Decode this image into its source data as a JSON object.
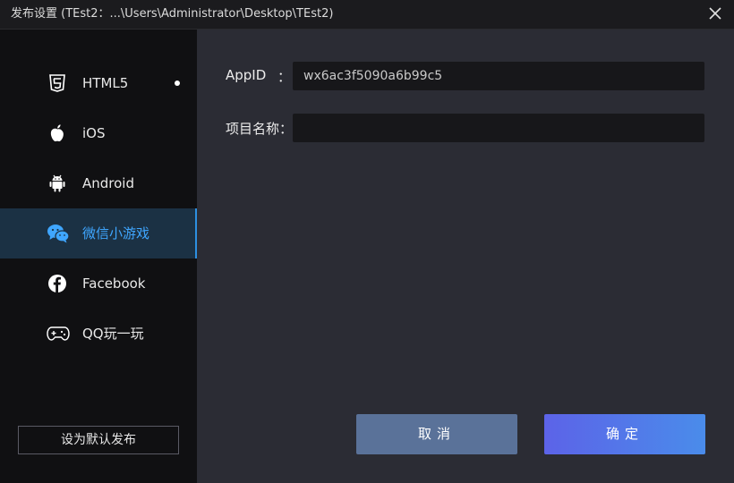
{
  "window": {
    "title": "发布设置 (TEst2：...\\Users\\Administrator\\Desktop\\TEst2)",
    "close_icon": "close-icon"
  },
  "sidebar": {
    "items": [
      {
        "label": "HTML5",
        "icon": "html5-icon",
        "selected_dot": true
      },
      {
        "label": "iOS",
        "icon": "apple-icon"
      },
      {
        "label": "Android",
        "icon": "android-icon"
      },
      {
        "label": "微信小游戏",
        "icon": "wechat-icon",
        "active": true
      },
      {
        "label": "Facebook",
        "icon": "facebook-icon"
      },
      {
        "label": "QQ玩一玩",
        "icon": "gamepad-icon"
      }
    ],
    "default_button": "设为默认发布"
  },
  "form": {
    "appid_label": "AppID",
    "appid_colon": "：",
    "appid_value": "wx6ac3f5090a6b99c5",
    "project_name_label": "项目名称：",
    "project_name_value": ""
  },
  "buttons": {
    "cancel": "取消",
    "ok": "确定"
  },
  "colors": {
    "accent": "#3fa6ff",
    "active_bg": "#1b3144",
    "cancel_bg": "#5a7299",
    "ok_gradient_start": "#5c63e8",
    "ok_gradient_end": "#4a8cea"
  }
}
